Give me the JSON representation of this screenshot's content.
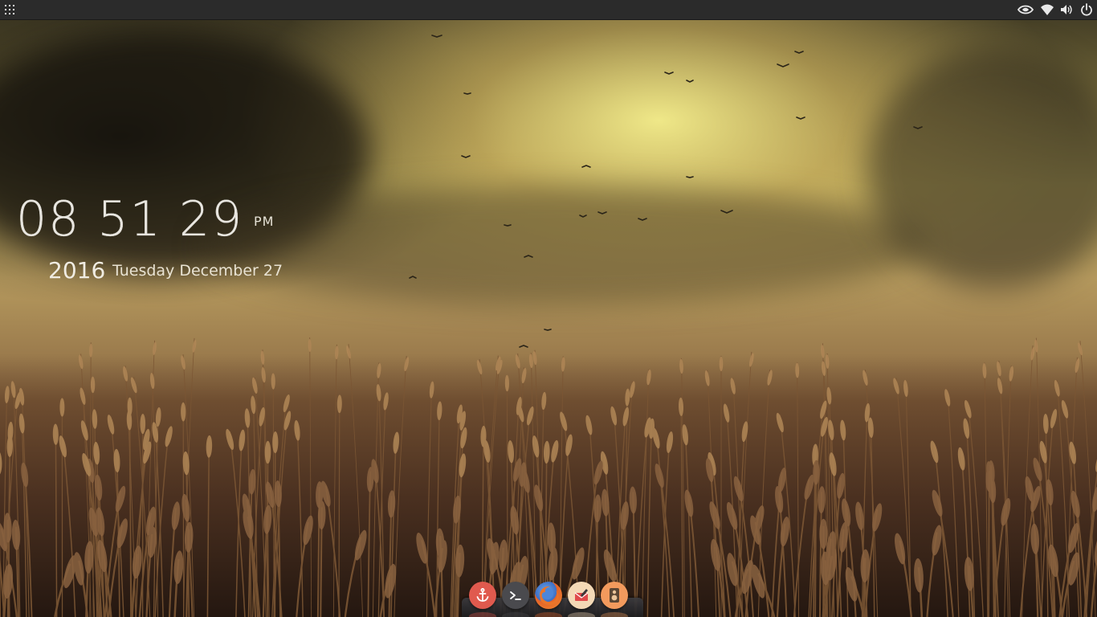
{
  "clock": {
    "time": "08 51 29",
    "ampm": "PM",
    "year": "2016",
    "date": "Tuesday December 27"
  },
  "top_panel": {
    "left_icons": [
      "apps-grid-icon"
    ],
    "right_icons": [
      "nvidia-icon",
      "wifi-icon",
      "volume-icon",
      "power-icon"
    ]
  },
  "dock": {
    "items": [
      {
        "icon": "anchor-icon",
        "color": "#e05a4e"
      },
      {
        "icon": "terminal-icon",
        "color": "#4a4a4e"
      },
      {
        "icon": "firefox-icon",
        "color": "#e3632a"
      },
      {
        "icon": "mail-icon",
        "color": "#f4d9b6"
      },
      {
        "icon": "speaker-icon",
        "color": "#f29a5d"
      }
    ]
  },
  "colors": {
    "panel": "#2b2b2b",
    "clock_text": "#f2f0ea"
  }
}
